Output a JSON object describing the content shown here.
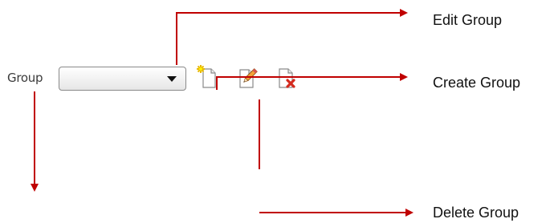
{
  "toolbar": {
    "group_label": "Group",
    "group_select_value": "",
    "icons": {
      "create": "new-document-icon",
      "edit": "edit-pencil-icon",
      "delete": "delete-document-icon",
      "dropdown": "chevron-down-icon"
    }
  },
  "annotations": {
    "edit_group": "Edit Group",
    "create_group": "Create Group",
    "delete_group": "Delete Group"
  },
  "colors": {
    "arrow": "#c00000",
    "label_text": "#3a3a3a",
    "annotation_text": "#111111"
  }
}
